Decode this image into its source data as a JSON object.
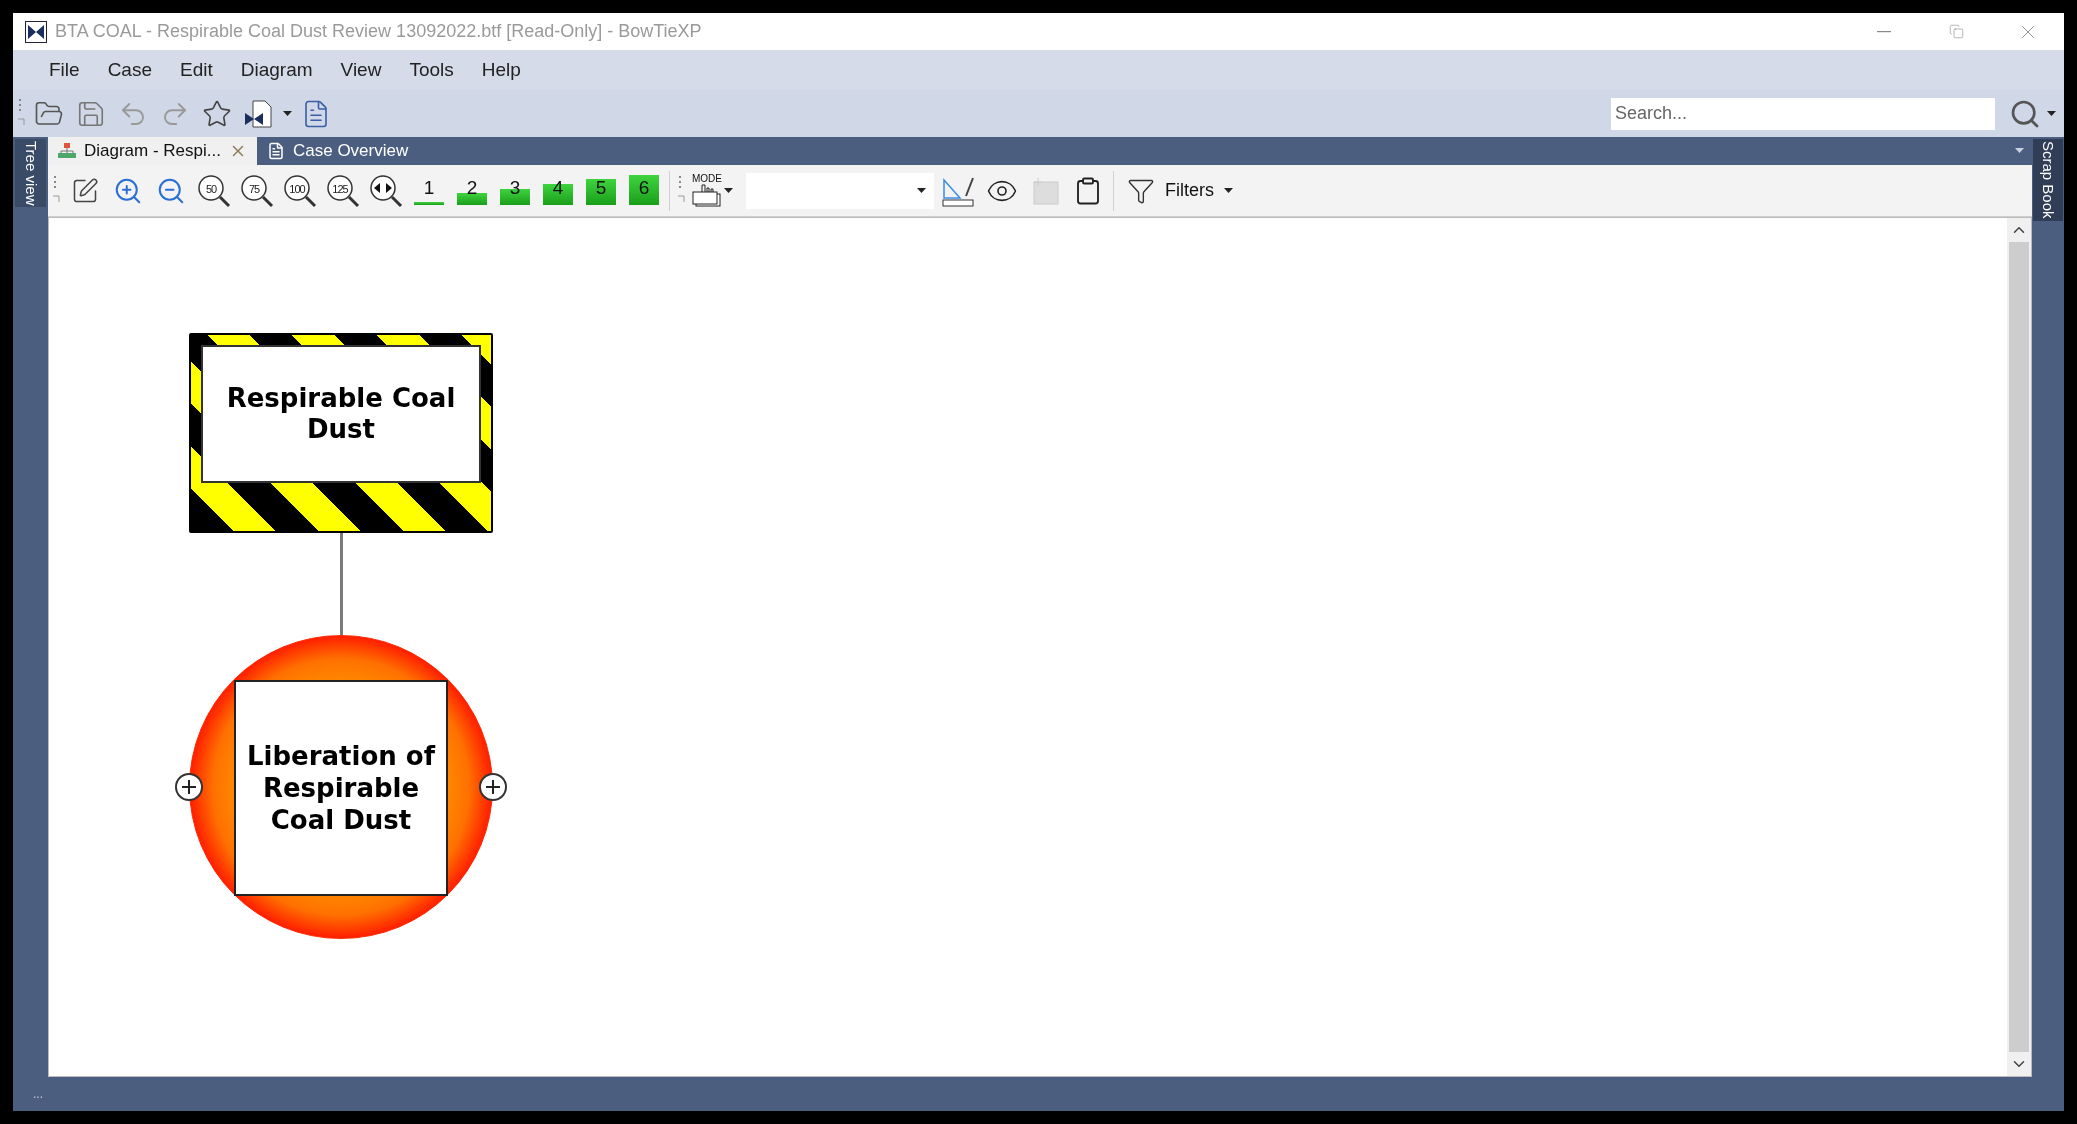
{
  "window": {
    "title": "BTA COAL - Respirable Coal Dust Review 13092022.btf [Read-Only] - BowTieXP"
  },
  "menu": [
    "File",
    "Case",
    "Edit",
    "Diagram",
    "View",
    "Tools",
    "Help"
  ],
  "search": {
    "placeholder": "Search..."
  },
  "side_panels": {
    "left": "Tree view",
    "right": "Scrap Book"
  },
  "tabs": [
    {
      "label": "Diagram -  Respi...",
      "selected": true
    },
    {
      "label": "Case Overview",
      "selected": false
    }
  ],
  "diagram_toolbar": {
    "zoom_levels": [
      "50",
      "75",
      "100",
      "125"
    ],
    "display_levels": [
      "1",
      "2",
      "3",
      "4",
      "5",
      "6"
    ],
    "mode_label": "MODE",
    "filters_label": "Filters"
  },
  "diagram": {
    "hazard": {
      "label": "Respirable Coal Dust"
    },
    "top_event": {
      "label": "Liberation of Respirable Coal Dust"
    }
  },
  "status_bar": "..."
}
